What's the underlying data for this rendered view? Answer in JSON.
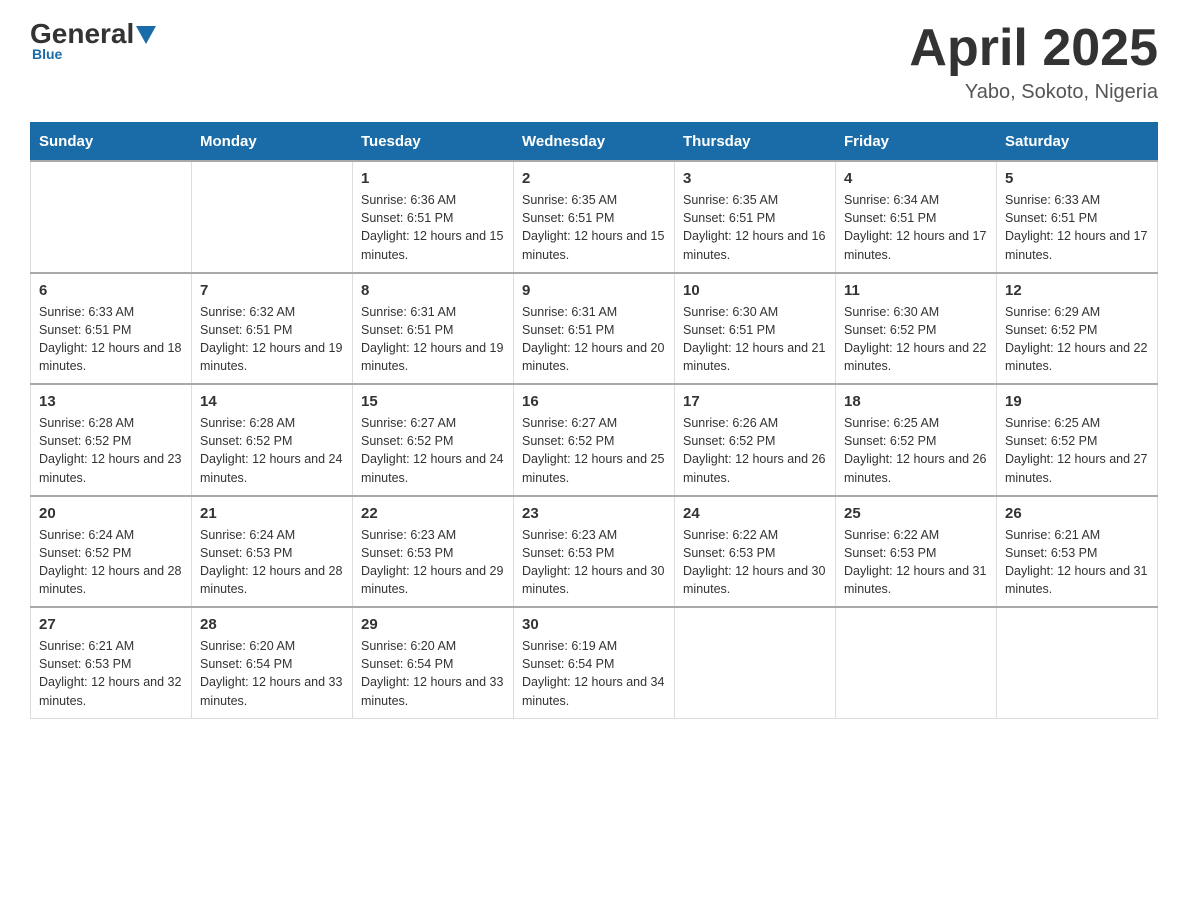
{
  "header": {
    "title": "April 2025",
    "subtitle": "Yabo, Sokoto, Nigeria"
  },
  "logo": {
    "general": "General",
    "blue": "Blue"
  },
  "weekdays": [
    "Sunday",
    "Monday",
    "Tuesday",
    "Wednesday",
    "Thursday",
    "Friday",
    "Saturday"
  ],
  "weeks": [
    [
      {
        "day": "",
        "sunrise": "",
        "sunset": "",
        "daylight": ""
      },
      {
        "day": "",
        "sunrise": "",
        "sunset": "",
        "daylight": ""
      },
      {
        "day": "1",
        "sunrise": "Sunrise: 6:36 AM",
        "sunset": "Sunset: 6:51 PM",
        "daylight": "Daylight: 12 hours and 15 minutes."
      },
      {
        "day": "2",
        "sunrise": "Sunrise: 6:35 AM",
        "sunset": "Sunset: 6:51 PM",
        "daylight": "Daylight: 12 hours and 15 minutes."
      },
      {
        "day": "3",
        "sunrise": "Sunrise: 6:35 AM",
        "sunset": "Sunset: 6:51 PM",
        "daylight": "Daylight: 12 hours and 16 minutes."
      },
      {
        "day": "4",
        "sunrise": "Sunrise: 6:34 AM",
        "sunset": "Sunset: 6:51 PM",
        "daylight": "Daylight: 12 hours and 17 minutes."
      },
      {
        "day": "5",
        "sunrise": "Sunrise: 6:33 AM",
        "sunset": "Sunset: 6:51 PM",
        "daylight": "Daylight: 12 hours and 17 minutes."
      }
    ],
    [
      {
        "day": "6",
        "sunrise": "Sunrise: 6:33 AM",
        "sunset": "Sunset: 6:51 PM",
        "daylight": "Daylight: 12 hours and 18 minutes."
      },
      {
        "day": "7",
        "sunrise": "Sunrise: 6:32 AM",
        "sunset": "Sunset: 6:51 PM",
        "daylight": "Daylight: 12 hours and 19 minutes."
      },
      {
        "day": "8",
        "sunrise": "Sunrise: 6:31 AM",
        "sunset": "Sunset: 6:51 PM",
        "daylight": "Daylight: 12 hours and 19 minutes."
      },
      {
        "day": "9",
        "sunrise": "Sunrise: 6:31 AM",
        "sunset": "Sunset: 6:51 PM",
        "daylight": "Daylight: 12 hours and 20 minutes."
      },
      {
        "day": "10",
        "sunrise": "Sunrise: 6:30 AM",
        "sunset": "Sunset: 6:51 PM",
        "daylight": "Daylight: 12 hours and 21 minutes."
      },
      {
        "day": "11",
        "sunrise": "Sunrise: 6:30 AM",
        "sunset": "Sunset: 6:52 PM",
        "daylight": "Daylight: 12 hours and 22 minutes."
      },
      {
        "day": "12",
        "sunrise": "Sunrise: 6:29 AM",
        "sunset": "Sunset: 6:52 PM",
        "daylight": "Daylight: 12 hours and 22 minutes."
      }
    ],
    [
      {
        "day": "13",
        "sunrise": "Sunrise: 6:28 AM",
        "sunset": "Sunset: 6:52 PM",
        "daylight": "Daylight: 12 hours and 23 minutes."
      },
      {
        "day": "14",
        "sunrise": "Sunrise: 6:28 AM",
        "sunset": "Sunset: 6:52 PM",
        "daylight": "Daylight: 12 hours and 24 minutes."
      },
      {
        "day": "15",
        "sunrise": "Sunrise: 6:27 AM",
        "sunset": "Sunset: 6:52 PM",
        "daylight": "Daylight: 12 hours and 24 minutes."
      },
      {
        "day": "16",
        "sunrise": "Sunrise: 6:27 AM",
        "sunset": "Sunset: 6:52 PM",
        "daylight": "Daylight: 12 hours and 25 minutes."
      },
      {
        "day": "17",
        "sunrise": "Sunrise: 6:26 AM",
        "sunset": "Sunset: 6:52 PM",
        "daylight": "Daylight: 12 hours and 26 minutes."
      },
      {
        "day": "18",
        "sunrise": "Sunrise: 6:25 AM",
        "sunset": "Sunset: 6:52 PM",
        "daylight": "Daylight: 12 hours and 26 minutes."
      },
      {
        "day": "19",
        "sunrise": "Sunrise: 6:25 AM",
        "sunset": "Sunset: 6:52 PM",
        "daylight": "Daylight: 12 hours and 27 minutes."
      }
    ],
    [
      {
        "day": "20",
        "sunrise": "Sunrise: 6:24 AM",
        "sunset": "Sunset: 6:52 PM",
        "daylight": "Daylight: 12 hours and 28 minutes."
      },
      {
        "day": "21",
        "sunrise": "Sunrise: 6:24 AM",
        "sunset": "Sunset: 6:53 PM",
        "daylight": "Daylight: 12 hours and 28 minutes."
      },
      {
        "day": "22",
        "sunrise": "Sunrise: 6:23 AM",
        "sunset": "Sunset: 6:53 PM",
        "daylight": "Daylight: 12 hours and 29 minutes."
      },
      {
        "day": "23",
        "sunrise": "Sunrise: 6:23 AM",
        "sunset": "Sunset: 6:53 PM",
        "daylight": "Daylight: 12 hours and 30 minutes."
      },
      {
        "day": "24",
        "sunrise": "Sunrise: 6:22 AM",
        "sunset": "Sunset: 6:53 PM",
        "daylight": "Daylight: 12 hours and 30 minutes."
      },
      {
        "day": "25",
        "sunrise": "Sunrise: 6:22 AM",
        "sunset": "Sunset: 6:53 PM",
        "daylight": "Daylight: 12 hours and 31 minutes."
      },
      {
        "day": "26",
        "sunrise": "Sunrise: 6:21 AM",
        "sunset": "Sunset: 6:53 PM",
        "daylight": "Daylight: 12 hours and 31 minutes."
      }
    ],
    [
      {
        "day": "27",
        "sunrise": "Sunrise: 6:21 AM",
        "sunset": "Sunset: 6:53 PM",
        "daylight": "Daylight: 12 hours and 32 minutes."
      },
      {
        "day": "28",
        "sunrise": "Sunrise: 6:20 AM",
        "sunset": "Sunset: 6:54 PM",
        "daylight": "Daylight: 12 hours and 33 minutes."
      },
      {
        "day": "29",
        "sunrise": "Sunrise: 6:20 AM",
        "sunset": "Sunset: 6:54 PM",
        "daylight": "Daylight: 12 hours and 33 minutes."
      },
      {
        "day": "30",
        "sunrise": "Sunrise: 6:19 AM",
        "sunset": "Sunset: 6:54 PM",
        "daylight": "Daylight: 12 hours and 34 minutes."
      },
      {
        "day": "",
        "sunrise": "",
        "sunset": "",
        "daylight": ""
      },
      {
        "day": "",
        "sunrise": "",
        "sunset": "",
        "daylight": ""
      },
      {
        "day": "",
        "sunrise": "",
        "sunset": "",
        "daylight": ""
      }
    ]
  ]
}
